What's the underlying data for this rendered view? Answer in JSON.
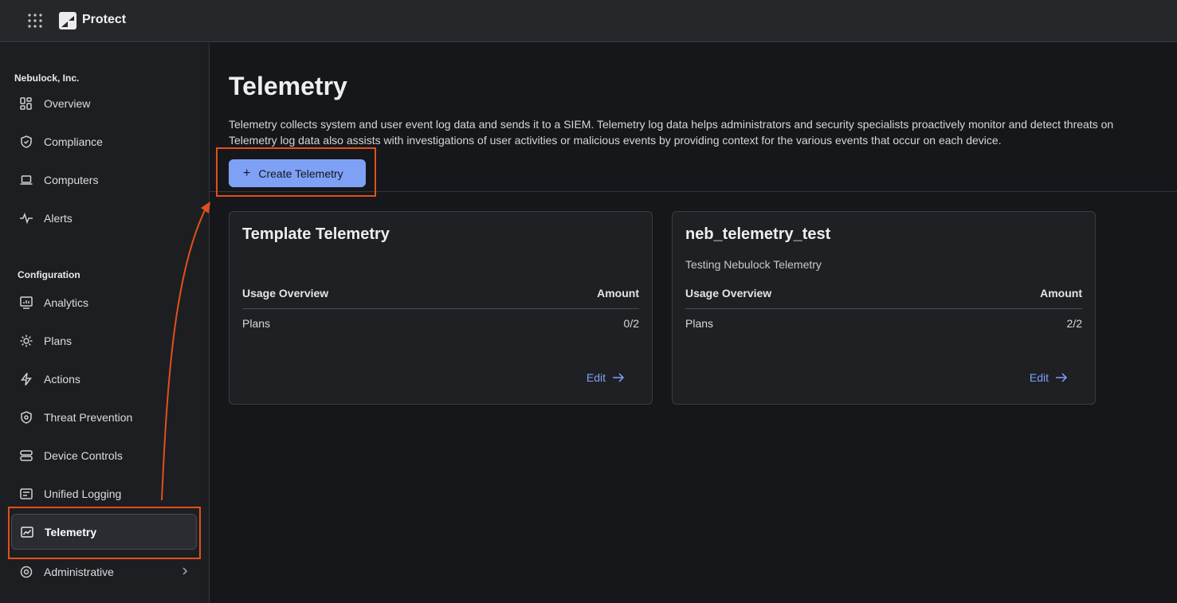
{
  "topbar": {
    "brand": "Protect",
    "apps_icon": "grid-icon",
    "logo_icon": "protect-logo"
  },
  "sidebar": {
    "org_name": "Nebulock, Inc.",
    "top_items": [
      {
        "label": "Overview",
        "icon": "overview-icon"
      },
      {
        "label": "Compliance",
        "icon": "shield-check-icon"
      },
      {
        "label": "Computers",
        "icon": "laptop-icon"
      },
      {
        "label": "Alerts",
        "icon": "pulse-icon"
      }
    ],
    "config_title": "Configuration",
    "config_items": [
      {
        "label": "Analytics",
        "icon": "analytics-icon"
      },
      {
        "label": "Plans",
        "icon": "gear-icon"
      },
      {
        "label": "Actions",
        "icon": "lightning-icon"
      },
      {
        "label": "Threat Prevention",
        "icon": "shield-icon"
      },
      {
        "label": "Device Controls",
        "icon": "storage-icon"
      },
      {
        "label": "Unified Logging",
        "icon": "logging-icon"
      },
      {
        "label": "Telemetry",
        "icon": "telemetry-icon",
        "active": true
      },
      {
        "label": "Administrative",
        "icon": "settings-icon"
      }
    ]
  },
  "main": {
    "title": "Telemetry",
    "description_line1": "Telemetry collects system and user event log data and sends it to a SIEM. Telemetry log data helps administrators and security specialists proactively monitor and detect threats on",
    "description_line2": "Telemetry log data also assists with investigations of user activities or malicious events by providing context for the various events that occur on each device.",
    "create_button": "Create Telemetry",
    "cards": [
      {
        "title": "Template Telemetry",
        "subtitle": "",
        "col_left": "Usage Overview",
        "col_right": "Amount",
        "row_label": "Plans",
        "row_value": "0/2",
        "edit": "Edit"
      },
      {
        "title": "neb_telemetry_test",
        "subtitle": "Testing Nebulock Telemetry",
        "col_left": "Usage Overview",
        "col_right": "Amount",
        "row_label": "Plans",
        "row_value": "2/2",
        "edit": "Edit"
      }
    ]
  },
  "colors": {
    "accent": "#7ea1f6",
    "annotation": "#e0501a"
  }
}
